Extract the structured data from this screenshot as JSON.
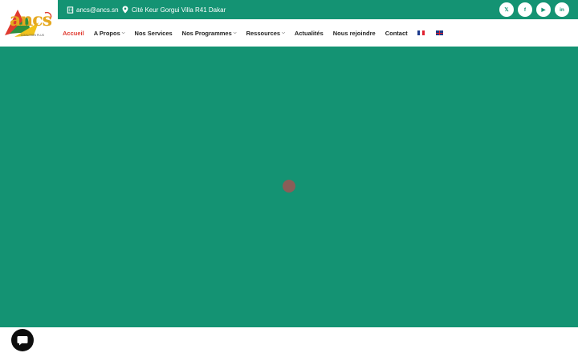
{
  "brand": {
    "logo_text": "ancs",
    "logo_tagline": "Alliance Nationale des Communautés pour la Santé",
    "logo_tagline2": "COALITION PLUS"
  },
  "topbar": {
    "email": "ancs@ancs.sn",
    "address": "Cité Keur Gorgui Villa R41 Dakar",
    "socials": [
      {
        "icon": "x-icon",
        "glyph": "𝕏"
      },
      {
        "icon": "facebook-icon",
        "glyph": "f"
      },
      {
        "icon": "youtube-icon",
        "glyph": "▶"
      },
      {
        "icon": "linkedin-icon",
        "glyph": "in"
      }
    ]
  },
  "nav": {
    "items": [
      {
        "label": "Accueil",
        "dropdown": false,
        "active": true
      },
      {
        "label": "A Propos",
        "dropdown": true
      },
      {
        "label": "Nos Services",
        "dropdown": false
      },
      {
        "label": "Nos Programmes",
        "dropdown": true
      },
      {
        "label": "Ressources",
        "dropdown": true
      },
      {
        "label": "Actualités",
        "dropdown": false
      },
      {
        "label": "Nous rejoindre",
        "dropdown": false
      },
      {
        "label": "Contact",
        "dropdown": false
      }
    ],
    "languages": [
      "fr",
      "en"
    ]
  },
  "colors": {
    "brand_green": "#149373",
    "accent_red": "#e03a2f",
    "loader": "#8a5e58"
  }
}
